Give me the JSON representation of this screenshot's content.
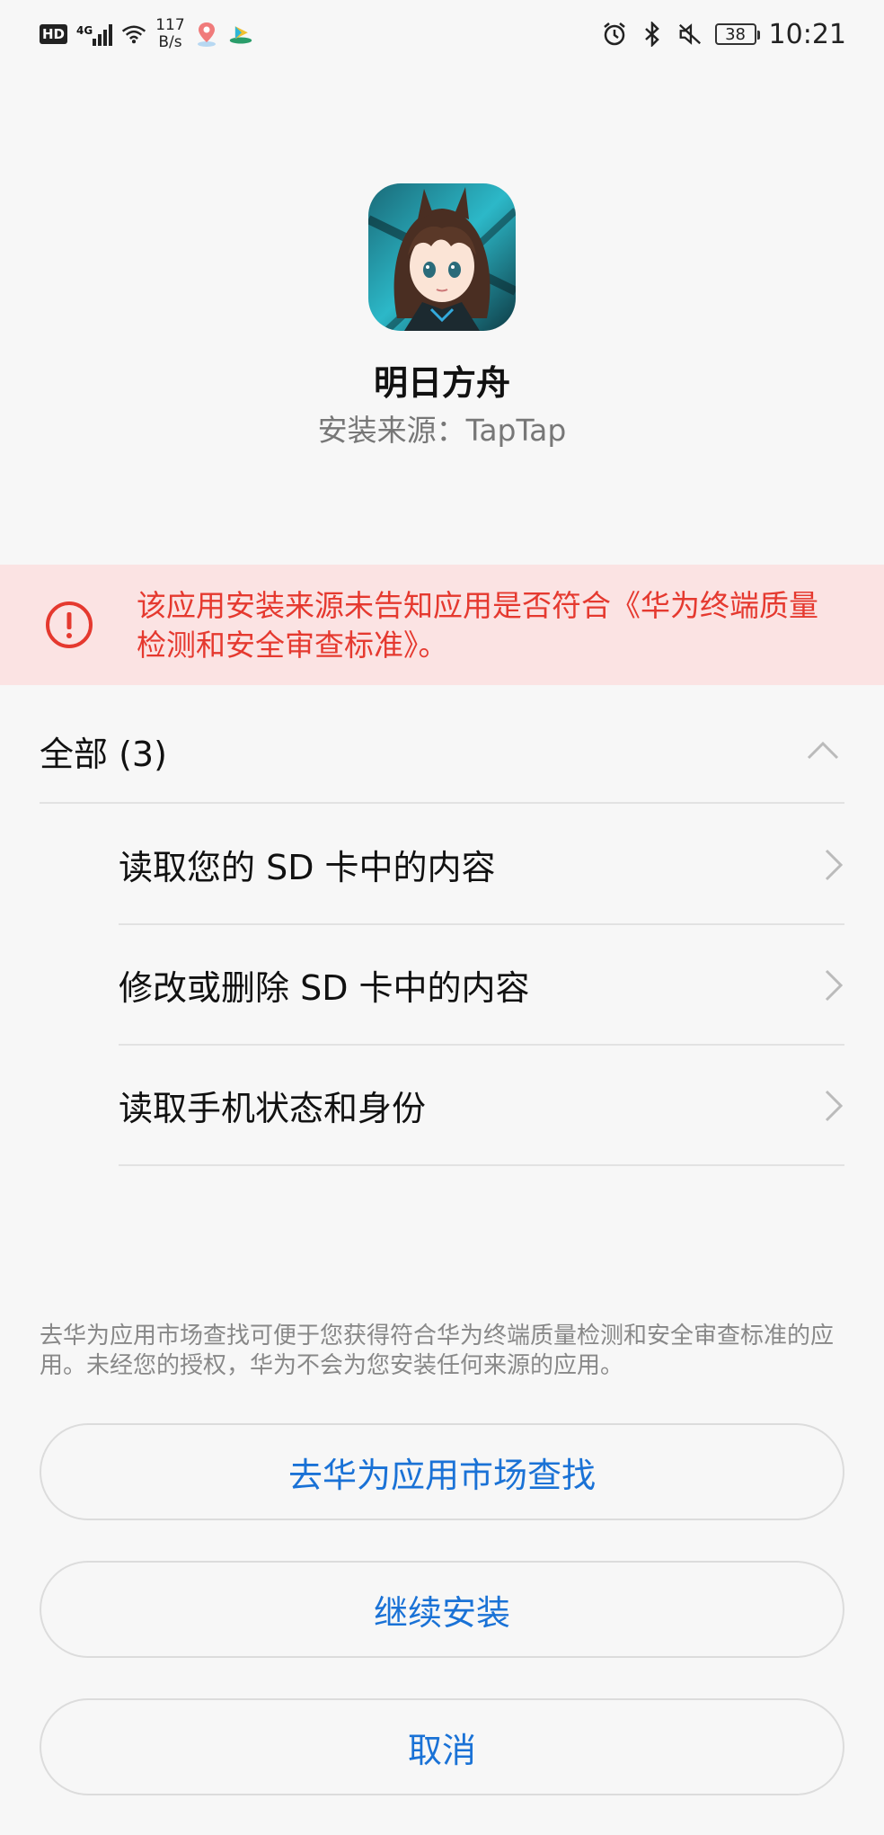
{
  "status_bar": {
    "hd": "HD",
    "network": "4G",
    "speed_value": "117",
    "speed_unit": "B/s",
    "battery": "38",
    "time": "10:21",
    "icons": [
      "hd-icon",
      "signal-icon",
      "wifi-icon",
      "maps-icon",
      "video-app-icon",
      "alarm-icon",
      "bluetooth-icon",
      "mute-icon",
      "battery-icon"
    ]
  },
  "app": {
    "name": "明日方舟",
    "source": "安装来源：TapTap"
  },
  "warning": {
    "text": "该应用安装来源未告知应用是否符合《华为终端质量检测和安全审查标准》。",
    "color": "#e5392f",
    "background": "#fbe3e3"
  },
  "permissions": {
    "title": "全部 (3)",
    "items": [
      {
        "label": "读取您的 SD 卡中的内容"
      },
      {
        "label": "修改或删除 SD 卡中的内容"
      },
      {
        "label": "读取手机状态和身份"
      }
    ]
  },
  "footer": {
    "note": "去华为应用市场查找可便于您获得符合华为终端质量检测和安全审查标准的应用。未经您的授权，华为不会为您安装任何来源的应用。",
    "buttons": {
      "market": "去华为应用市场查找",
      "continue": "继续安装",
      "cancel": "取消"
    },
    "accent": "#1a72d6"
  }
}
